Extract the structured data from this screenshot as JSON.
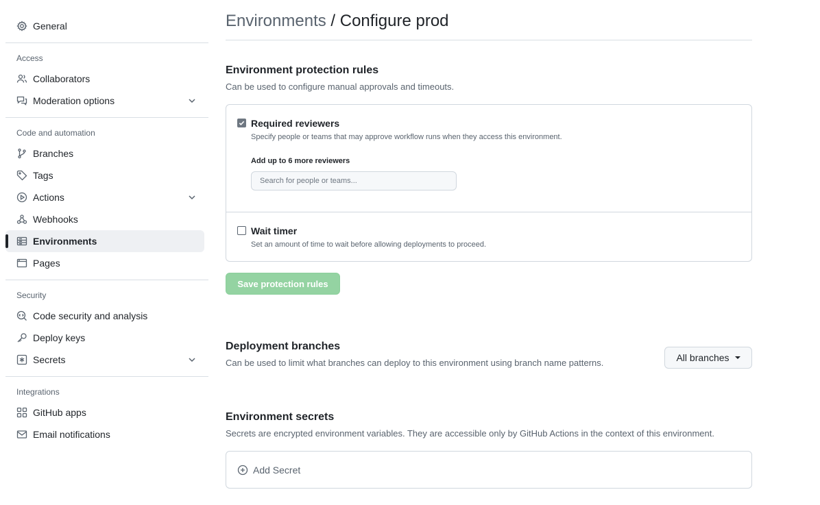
{
  "sidebar": {
    "general": "General",
    "access_title": "Access",
    "collaborators": "Collaborators",
    "moderation": "Moderation options",
    "code_title": "Code and automation",
    "branches": "Branches",
    "tags": "Tags",
    "actions": "Actions",
    "webhooks": "Webhooks",
    "environments": "Environments",
    "pages": "Pages",
    "security_title": "Security",
    "code_security": "Code security and analysis",
    "deploy_keys": "Deploy keys",
    "secrets": "Secrets",
    "integrations_title": "Integrations",
    "github_apps": "GitHub apps",
    "email_notifications": "Email notifications",
    "active_item": "Environments"
  },
  "header": {
    "breadcrumb": "Environments",
    "separator": " / ",
    "title": "Configure prod"
  },
  "protection": {
    "title": "Environment protection rules",
    "description": "Can be used to configure manual approvals and timeouts.",
    "reviewers": {
      "checked": true,
      "label": "Required reviewers",
      "note": "Specify people or teams that may approve workflow runs when they access this environment.",
      "add_label": "Add up to 6 more reviewers",
      "search_placeholder": "Search for people or teams..."
    },
    "wait_timer": {
      "checked": false,
      "label": "Wait timer",
      "note": "Set an amount of time to wait before allowing deployments to proceed."
    },
    "save_button": "Save protection rules"
  },
  "deployment_branches": {
    "title": "Deployment branches",
    "description": "Can be used to limit what branches can deploy to this environment using branch name patterns.",
    "selected": "All branches"
  },
  "secrets_section": {
    "title": "Environment secrets",
    "description": "Secrets are encrypted environment variables. They are accessible only by GitHub Actions in the context of this environment.",
    "add_secret": "Add Secret"
  },
  "colors": {
    "save_button_bg": "#94d3a2",
    "text": "#1f2328",
    "muted": "#59636e",
    "border": "#d0d7de"
  }
}
